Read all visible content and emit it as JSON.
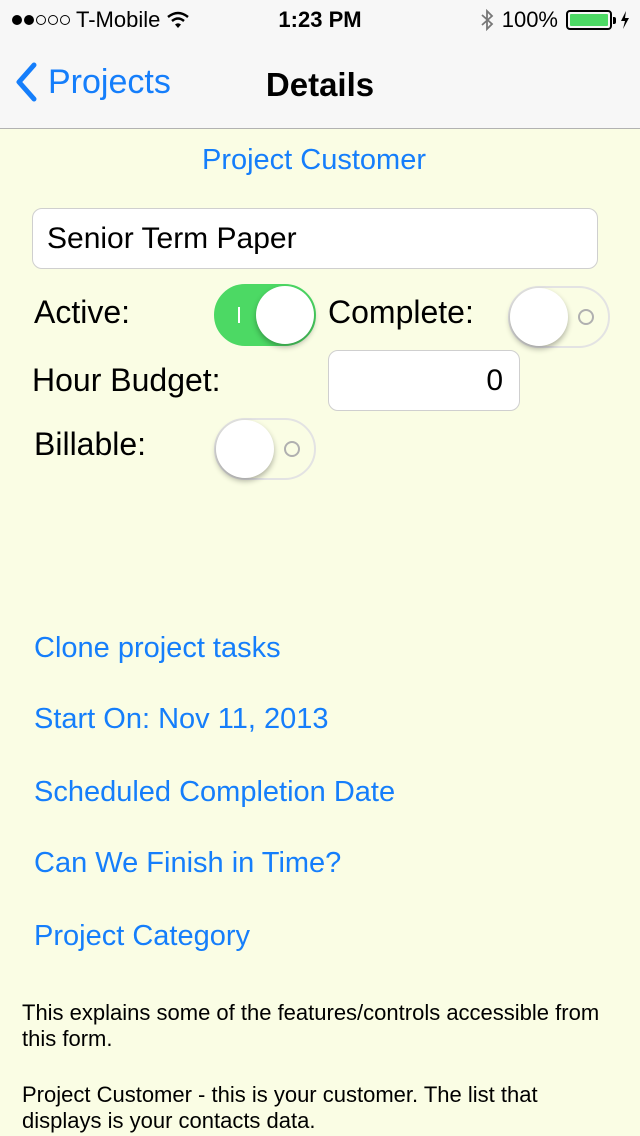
{
  "status": {
    "carrier": "T-Mobile",
    "time": "1:23 PM",
    "battery": "100%"
  },
  "nav": {
    "back_label": "Projects",
    "title": "Details"
  },
  "form": {
    "customer_label": "Project Customer",
    "project_name": "Senior Term Paper",
    "active_label": "Active:",
    "active_on": true,
    "complete_label": "Complete:",
    "complete_on": false,
    "hour_budget_label": "Hour Budget:",
    "hour_budget_value": "0",
    "billable_label": "Billable:",
    "billable_on": false
  },
  "links": {
    "clone": "Clone project tasks",
    "start": "Start On: Nov 11, 2013",
    "scheduled": "Scheduled Completion Date",
    "finish": "Can We Finish in Time?",
    "category": "Project Category"
  },
  "help": {
    "intro": "This explains some of the features/controls accessible from this form.",
    "customer": "Project Customer - this is your customer. The list that displays is your contacts data."
  },
  "colors": {
    "accent": "#157efb",
    "switch_on": "#4cd964",
    "background": "#fafde4"
  }
}
